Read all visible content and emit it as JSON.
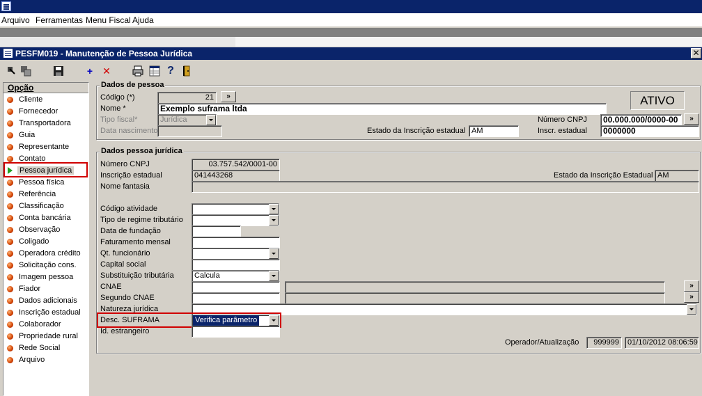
{
  "menubar": [
    "Arquivo",
    "Ferramentas",
    "Menu Fiscal",
    "Ajuda"
  ],
  "window": {
    "title": "PESFM019 - Manutenção de Pessoa Jurídica",
    "close": "✕"
  },
  "left_panel": {
    "header": "Opção",
    "items": [
      "Cliente",
      "Fornecedor",
      "Transportadora",
      "Guia",
      "Representante",
      "Contato",
      "Pessoa jurídica",
      "Pessoa física",
      "Referência",
      "Classificação",
      "Conta bancária",
      "Observação",
      "Coligado",
      "Operadora crédito",
      "Solicitação cons.",
      "Imagem pessoa",
      "Fiador",
      "Dados adicionais",
      "Inscrição estadual",
      "Colaborador",
      "Propriedade rural",
      "Rede Social",
      "Arquivo"
    ],
    "selected_index": 6
  },
  "dados_pessoa": {
    "title": "Dados de pessoa",
    "codigo_label": "Código (*)",
    "codigo_value": "21",
    "nome_label": "Nome *",
    "nome_value": "Exemplo suframa ltda",
    "status": "ATIVO",
    "tipo_fiscal_label": "Tipo fiscal*",
    "tipo_fiscal_value": "Jurídica",
    "data_nasc_label": "Data nascimento",
    "estado_insc_label": "Estado da Inscrição estadual",
    "estado_insc_value": "AM",
    "cnpj_label": "Número CNPJ",
    "cnpj_value": "00.000.000/0000-00",
    "inscr_label": "Inscr. estadual",
    "inscr_value": "0000000",
    "btn": "»"
  },
  "dados_pj": {
    "title": "Dados pessoa jurídica",
    "cnpj_label": "Número CNPJ",
    "cnpj_value": "03.757.542/0001-00",
    "insc_label": "Inscrição estadual",
    "insc_value": "041443268",
    "estado_label": "Estado da Inscrição Estadual",
    "estado_value": "AM",
    "fantasia_label": "Nome fantasia",
    "codigo_atividade": "Código atividade",
    "regime": "Tipo de regime tributário",
    "fundacao": "Data de fundação",
    "faturamento": "Faturamento mensal",
    "funcionario": "Qt. funcionário",
    "capital": "Capital social",
    "subst_label": "Substituição tributária",
    "subst_value": "Calcula",
    "cnae": "CNAE",
    "segundo_cnae": "Segundo CNAE",
    "natureza": "Natureza jurídica",
    "suframa_label": "Desc. SUFRAMA",
    "suframa_value": "Verifica parâmetro",
    "estrangeiro": "Id. estrangeiro",
    "operador_label": "Operador/Atualização",
    "operador_value": "999999",
    "atualizacao_value": "01/10/2012 08:06:59",
    "btn": "»"
  }
}
